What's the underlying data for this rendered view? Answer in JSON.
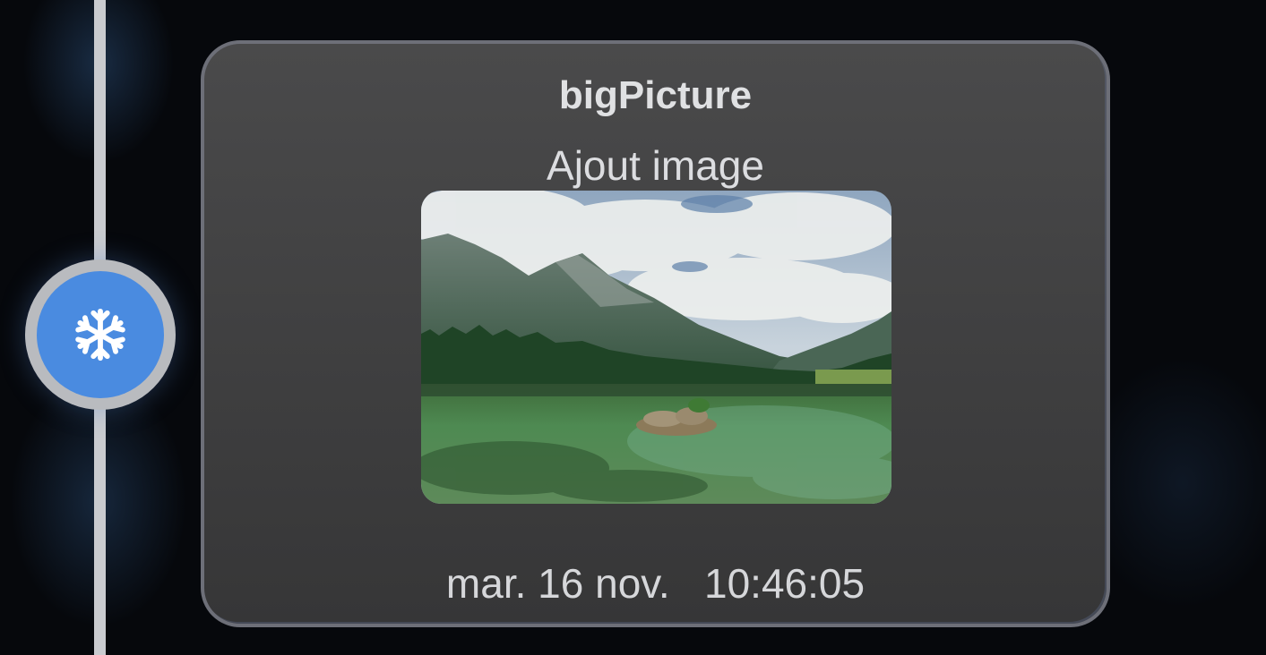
{
  "timeline": {
    "node_icon": "snowflake-icon",
    "node_color": "#4a8be0"
  },
  "notification": {
    "title": "bigPicture",
    "text": "Ajout image",
    "image_description": "mountain-lake-landscape",
    "date": "mar. 16 nov.",
    "time": "10:46:05"
  }
}
